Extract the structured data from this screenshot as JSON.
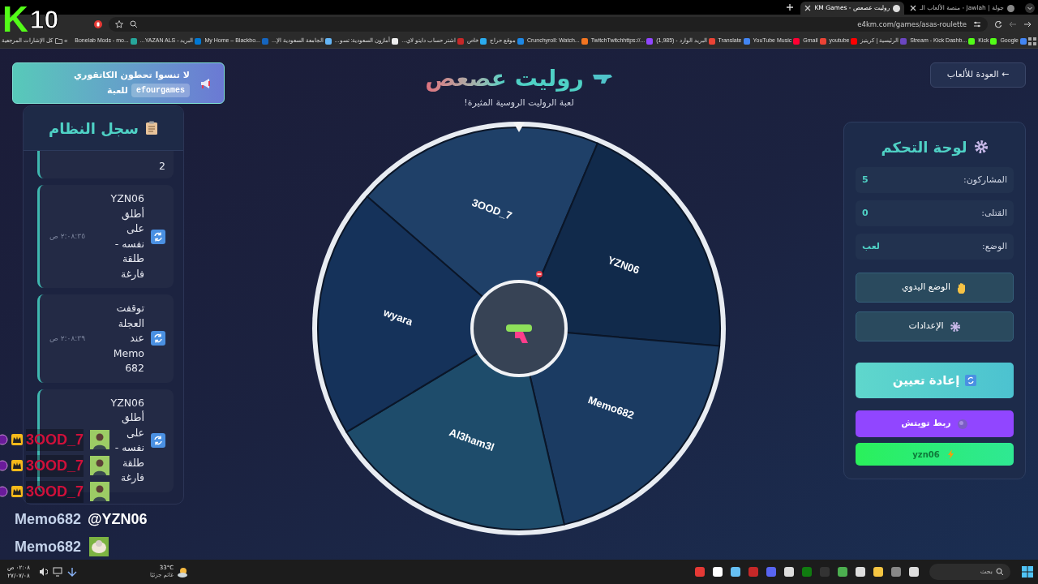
{
  "browser": {
    "tabs": [
      {
        "title": "جولة | Jawlah - منصة الألعاب الـ",
        "selected": false
      },
      {
        "title": "روليت عصعص - KM Games",
        "selected": true
      }
    ],
    "address": "e4km.com/games/asas-roulette",
    "bookmarks": [
      {
        "label": "Google",
        "color": "#4285f4"
      },
      {
        "label": "Kick",
        "color": "#53fc18"
      },
      {
        "label": "Stream - Kick Dashb...",
        "color": "#53fc18"
      },
      {
        "label": "الرئيسية | كريتيز",
        "color": "#6b46c1"
      },
      {
        "label": "youtube",
        "color": "#ff0000"
      },
      {
        "label": "Gmail",
        "color": "#ea4335"
      },
      {
        "label": "YouTube Music",
        "color": "#ff0033"
      },
      {
        "label": "Translate",
        "color": "#4285f4"
      },
      {
        "label": "البريد الوارد - (1,985)",
        "color": "#ea4335"
      },
      {
        "label": "TwitchTwitchhttps://...",
        "color": "#9146ff"
      },
      {
        "label": "Crunchyroll: Watch...",
        "color": "#f47521"
      },
      {
        "label": "موقع حراج",
        "color": "#1e88e5"
      },
      {
        "label": "خاص",
        "color": "#2aabee"
      },
      {
        "label": "اشتر حساب دايتو لاي...",
        "color": "#c62828"
      },
      {
        "label": "أمازون السعودية: تسو...",
        "color": "#eeeeee"
      },
      {
        "label": "الجامعة السعودية الإ...",
        "color": "#64b5f6"
      },
      {
        "label": "My Home – Blackbo...",
        "color": "#1565c0"
      },
      {
        "label": "البريد - YAZAN ALS...",
        "color": "#0078d4"
      },
      {
        "label": "Bonelab Mods - mo...",
        "color": "#26a69a"
      }
    ],
    "more": "»",
    "all_bookmarks": "كل الإشارات المرجعية"
  },
  "stream_overlay": {
    "logo_letter": "K",
    "logo_number": "10",
    "chat": [
      {
        "kind": "badge",
        "user": "3OOD_7"
      },
      {
        "kind": "badge",
        "user": "3OOD_7"
      },
      {
        "kind": "badge",
        "user": "3OOD_7"
      },
      {
        "kind": "mention",
        "user": "Memo682",
        "message": "@YZN06"
      },
      {
        "kind": "emote",
        "user": "Memo682"
      }
    ]
  },
  "announcement": {
    "line_1": "لا تنسوا تحطون الكاتقوري",
    "tag": "efourgames",
    "line_2_end": "للعبة"
  },
  "log": {
    "title": "سجل النظام",
    "entries": [
      {
        "text": "2"
      },
      {
        "text": "YZN06 أطلق على نفسه - طلقة فارغة",
        "time": "٢:٠٨:٣٥ ص"
      },
      {
        "text": "توقفت العجلة عند Memo682",
        "time": "٢:٠٨:٣٩ ص"
      },
      {
        "text": "YZN06 أطلق على نفسه - طلقة فارغة"
      }
    ]
  },
  "header": {
    "title": "روليت عصعص",
    "subtitle": "لعبة الروليت الروسية المثيرة!",
    "back_button": "← العودة للألعاب"
  },
  "wheel": {
    "segments": [
      {
        "name": "3OOD_7",
        "color": "#1f4068"
      },
      {
        "name": "YZN06",
        "color": "#112a4b"
      },
      {
        "name": "Memo682",
        "color": "#1b3b62"
      },
      {
        "name": "Al3ham3l",
        "color": "#1e4c6b"
      },
      {
        "name": "wyara",
        "color": "#15325a"
      }
    ]
  },
  "control_panel": {
    "title": "لوحة التحكم",
    "stats": [
      {
        "label": "المشاركون:",
        "value": "5"
      },
      {
        "label": "القتلى:",
        "value": "0"
      },
      {
        "label": "الوضع:",
        "value": "لعب"
      }
    ],
    "buttons": [
      {
        "kind": "manual",
        "label": "الوضع اليدوي"
      },
      {
        "kind": "settings",
        "label": "الإعدادات"
      },
      {
        "kind": "reset",
        "label": "إعادة تعيين"
      },
      {
        "kind": "twitch",
        "label": "ربط تويتش"
      },
      {
        "kind": "kick",
        "label": "yzn06"
      }
    ]
  },
  "taskbar": {
    "search_placeholder": "بحث",
    "weather_temp": "33°C",
    "weather_text": "غائم جزئيًا",
    "time": "٠٢:٠٨ ص",
    "date": "٢٧/٠٧/٠٨"
  }
}
